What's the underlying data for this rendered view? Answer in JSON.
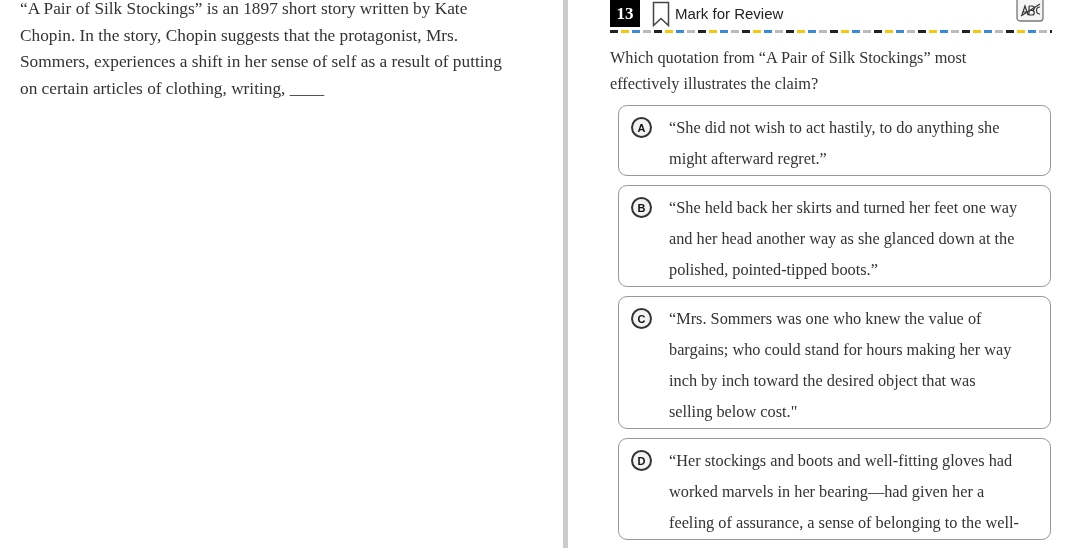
{
  "passage": {
    "text": "“A Pair of Silk Stockings” is an 1897 short story written by Kate\nChopin. In the story, Chopin suggests that the protagonist, Mrs.\nSommers, experiences a shift in her sense of self as a result of putting\non certain articles of clothing, writing, ____"
  },
  "question_header": {
    "number": "13",
    "mark_for_review": {
      "label": "Mark for Review",
      "checked": false
    }
  },
  "prompt": "Which quotation from “A Pair of Silk Stockings” most\neffectively illustrates the claim?",
  "options": [
    {
      "letter": "A",
      "selected": false,
      "text": "“She did not wish to act hastily, to do anything she\nmight afterward regret.”"
    },
    {
      "letter": "B",
      "selected": false,
      "text": "“She held back her skirts and turned her feet one way\nand her head another way as she glanced down at the\npolished, pointed-tipped boots.”"
    },
    {
      "letter": "C",
      "selected": false,
      "text": "“Mrs. Sommers was one who knew the value of\nbargains; who could stand for hours making her way\ninch by inch toward the desired object that was\nselling below cost.\""
    },
    {
      "letter": "D",
      "selected": false,
      "text": "“Her stockings and boots and well-fitting gloves had\nworked marvels in her bearing—had given her a\nfeeling of assurance, a sense of belonging to the well-"
    }
  ]
}
